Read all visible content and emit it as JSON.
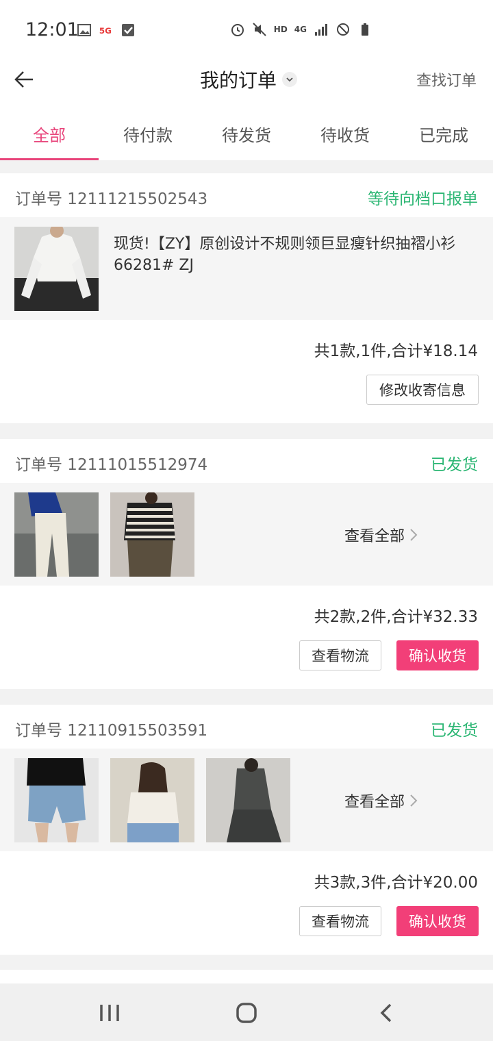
{
  "status_bar": {
    "time": "12:01",
    "hd": "HD",
    "network": "4G",
    "icons_left": [
      "image-icon",
      "5g-icon",
      "check-icon"
    ],
    "icons_right": [
      "alarm-icon",
      "mute-icon",
      "signal-icon",
      "blocked-icon",
      "battery-icon"
    ]
  },
  "header": {
    "title": "我的订单",
    "find_orders": "查找订单"
  },
  "tabs": [
    {
      "label": "全部",
      "active": true
    },
    {
      "label": "待付款",
      "active": false
    },
    {
      "label": "待发货",
      "active": false
    },
    {
      "label": "待收货",
      "active": false
    },
    {
      "label": "已完成",
      "active": false
    }
  ],
  "orders": [
    {
      "order_label": "订单号 12111215502543",
      "status": "等待向档口报单",
      "product_name": "现货!【ZY】原创设计不规则领巨显瘦针织抽褶小衫  66281#  ZJ",
      "summary": "共1款,1件,合计¥18.14",
      "buttons": [
        "修改收寄信息"
      ]
    },
    {
      "order_label": "订单号 12111015512974",
      "status": "已发货",
      "view_all": "查看全部",
      "summary": "共2款,2件,合计¥32.33",
      "buttons": [
        "查看物流",
        "确认收货"
      ]
    },
    {
      "order_label": "订单号 12110915503591",
      "status": "已发货",
      "view_all": "查看全部",
      "summary": "共3款,3件,合计¥20.00",
      "buttons": [
        "查看物流",
        "确认收货"
      ]
    }
  ],
  "colors": {
    "accent": "#e8457b",
    "primary_button": "#f23f78",
    "status_green": "#2bb673"
  }
}
